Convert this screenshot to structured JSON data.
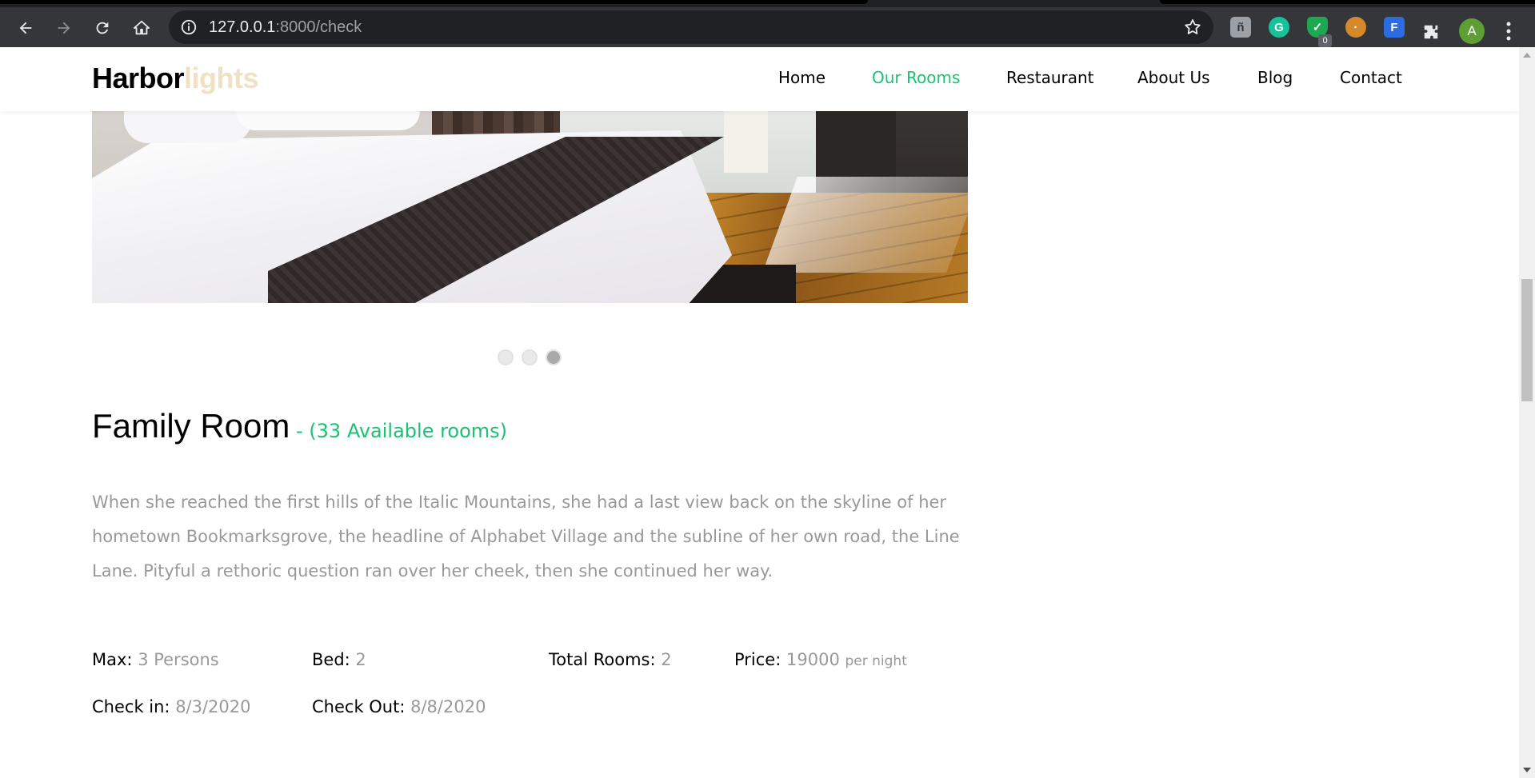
{
  "browser": {
    "url_host": "127.0.0.1",
    "url_path": ":8000/check",
    "profile_initial": "A",
    "extension_badge": "0",
    "icons": [
      "back-arrow-icon",
      "forward-arrow-icon",
      "reload-icon",
      "home-icon",
      "info-icon",
      "bookmark-star-icon",
      "extension-tampermonkey-icon",
      "grammarly-icon",
      "shield-check-icon",
      "cookie-icon",
      "feedly-icon",
      "puzzle-extensions-icon",
      "kebab-menu-icon"
    ]
  },
  "site": {
    "brand_main": "Harbor",
    "brand_accent": "lights",
    "nav": [
      {
        "label": "Home",
        "active": false
      },
      {
        "label": "Our Rooms",
        "active": true
      },
      {
        "label": "Restaurant",
        "active": false
      },
      {
        "label": "About Us",
        "active": false
      },
      {
        "label": "Blog",
        "active": false
      },
      {
        "label": "Contact",
        "active": false
      }
    ],
    "accent_color": "#1cc174"
  },
  "carousel": {
    "dots": 3,
    "active_index": 2
  },
  "room": {
    "title": "Family Room",
    "availability": "- (33 Available rooms)",
    "description": "When she reached the first hills of the Italic Mountains, she had a last view back on the skyline of her hometown Bookmarksgrove, the headline of Alphabet Village and the subline of her own road, the Line Lane. Pityful a rethoric question ran over her cheek, then she continued her way.",
    "specs": {
      "max_label": "Max:",
      "max_value": "3 Persons",
      "bed_label": "Bed:",
      "bed_value": "2",
      "total_label": "Total Rooms:",
      "total_value": "2",
      "price_label": "Price:",
      "price_value": "19000",
      "price_unit": "per night",
      "checkin_label": "Check in:",
      "checkin_value": "8/3/2020",
      "checkout_label": "Check Out:",
      "checkout_value": "8/8/2020"
    }
  }
}
